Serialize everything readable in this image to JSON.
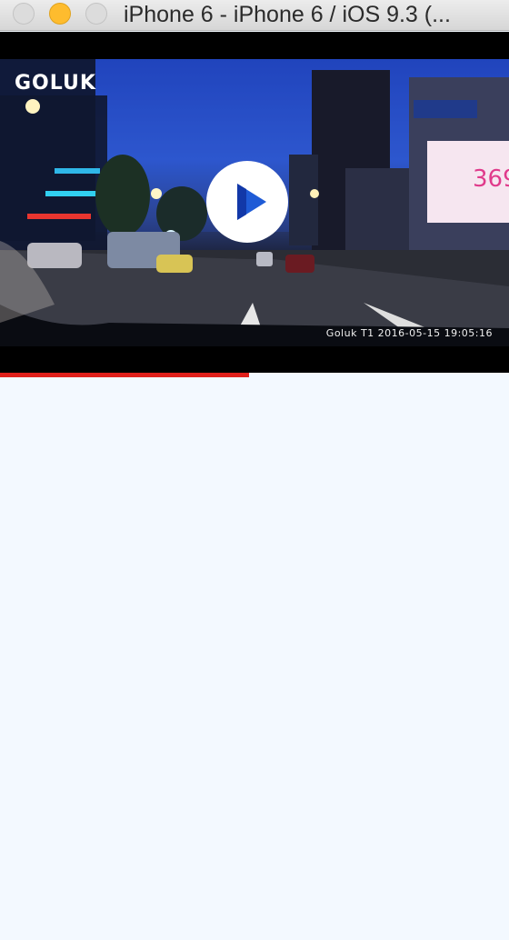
{
  "window": {
    "title": "iPhone 6 - iPhone 6 / iOS 9.3 (..."
  },
  "video": {
    "watermark_logo": "GOLUK",
    "timestamp": "Goluk T1 2016-05-15 19:05:16",
    "play_icon": "play-icon",
    "progress": 0.49
  },
  "colors": {
    "progress_fill": "#e0201b",
    "background": "#f3f9ff",
    "minimize_button": "#febc2e"
  }
}
